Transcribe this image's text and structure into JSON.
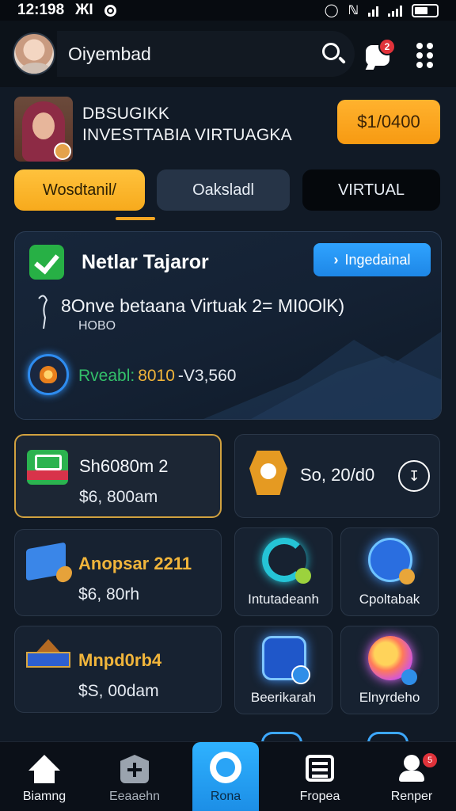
{
  "status_bar": {
    "time": "12:198",
    "carrier_glyph": "ЖI"
  },
  "header": {
    "app_title": "Oiyembad",
    "chat_badge": "2"
  },
  "profile": {
    "line1": "DBSUGIKK",
    "line2": "INVESTTABIA VIRTUAGKA",
    "balance_button": "$1/0400"
  },
  "tabs": [
    {
      "label": "Wosdtanil/",
      "active": true
    },
    {
      "label": "Oaksladl",
      "active": false
    },
    {
      "label": "VIRTUAL",
      "active": false
    }
  ],
  "feature_card": {
    "title": "Netlar Tajaror",
    "button_label": "Ingedainal",
    "description": "8Onve betaana Virtuak 2= MI0OlK)",
    "sub": "HOBO",
    "reward_label": "Rveabl:",
    "reward_value": "8010",
    "reward_value2": "-V3,560"
  },
  "tiles": {
    "big_1": {
      "title": "Sh6080m 2",
      "amount": "$6, 800am"
    },
    "big_2": {
      "title": "So, 20/d0"
    },
    "mid_1": {
      "title": "Anopsar 2211",
      "amount": "$6, 80rh"
    },
    "mid_2": {
      "title": "Mnpd0rb4",
      "amount": "$S, 00dam"
    },
    "small": [
      {
        "label": "Intutadeanh",
        "icon": "ring-icon"
      },
      {
        "label": "Cpoltabak",
        "icon": "chart-card-icon"
      },
      {
        "label": "Beerikarah",
        "icon": "app-card-icon"
      },
      {
        "label": "Elnyrdeho",
        "icon": "orb-icon"
      }
    ]
  },
  "bottom_nav": {
    "items": [
      {
        "label": "Biamng",
        "icon": "home-icon"
      },
      {
        "label": "Eeaaehn",
        "icon": "add-icon"
      },
      {
        "label": "Rona",
        "icon": "circle-icon",
        "active": true
      },
      {
        "label": "Fropea",
        "icon": "news-icon"
      },
      {
        "label": "Renper",
        "icon": "profile-icon",
        "badge": "5"
      }
    ]
  },
  "colors": {
    "accent_gold": "#f7aa1c",
    "accent_blue": "#1e87e6",
    "background": "#111a26"
  }
}
